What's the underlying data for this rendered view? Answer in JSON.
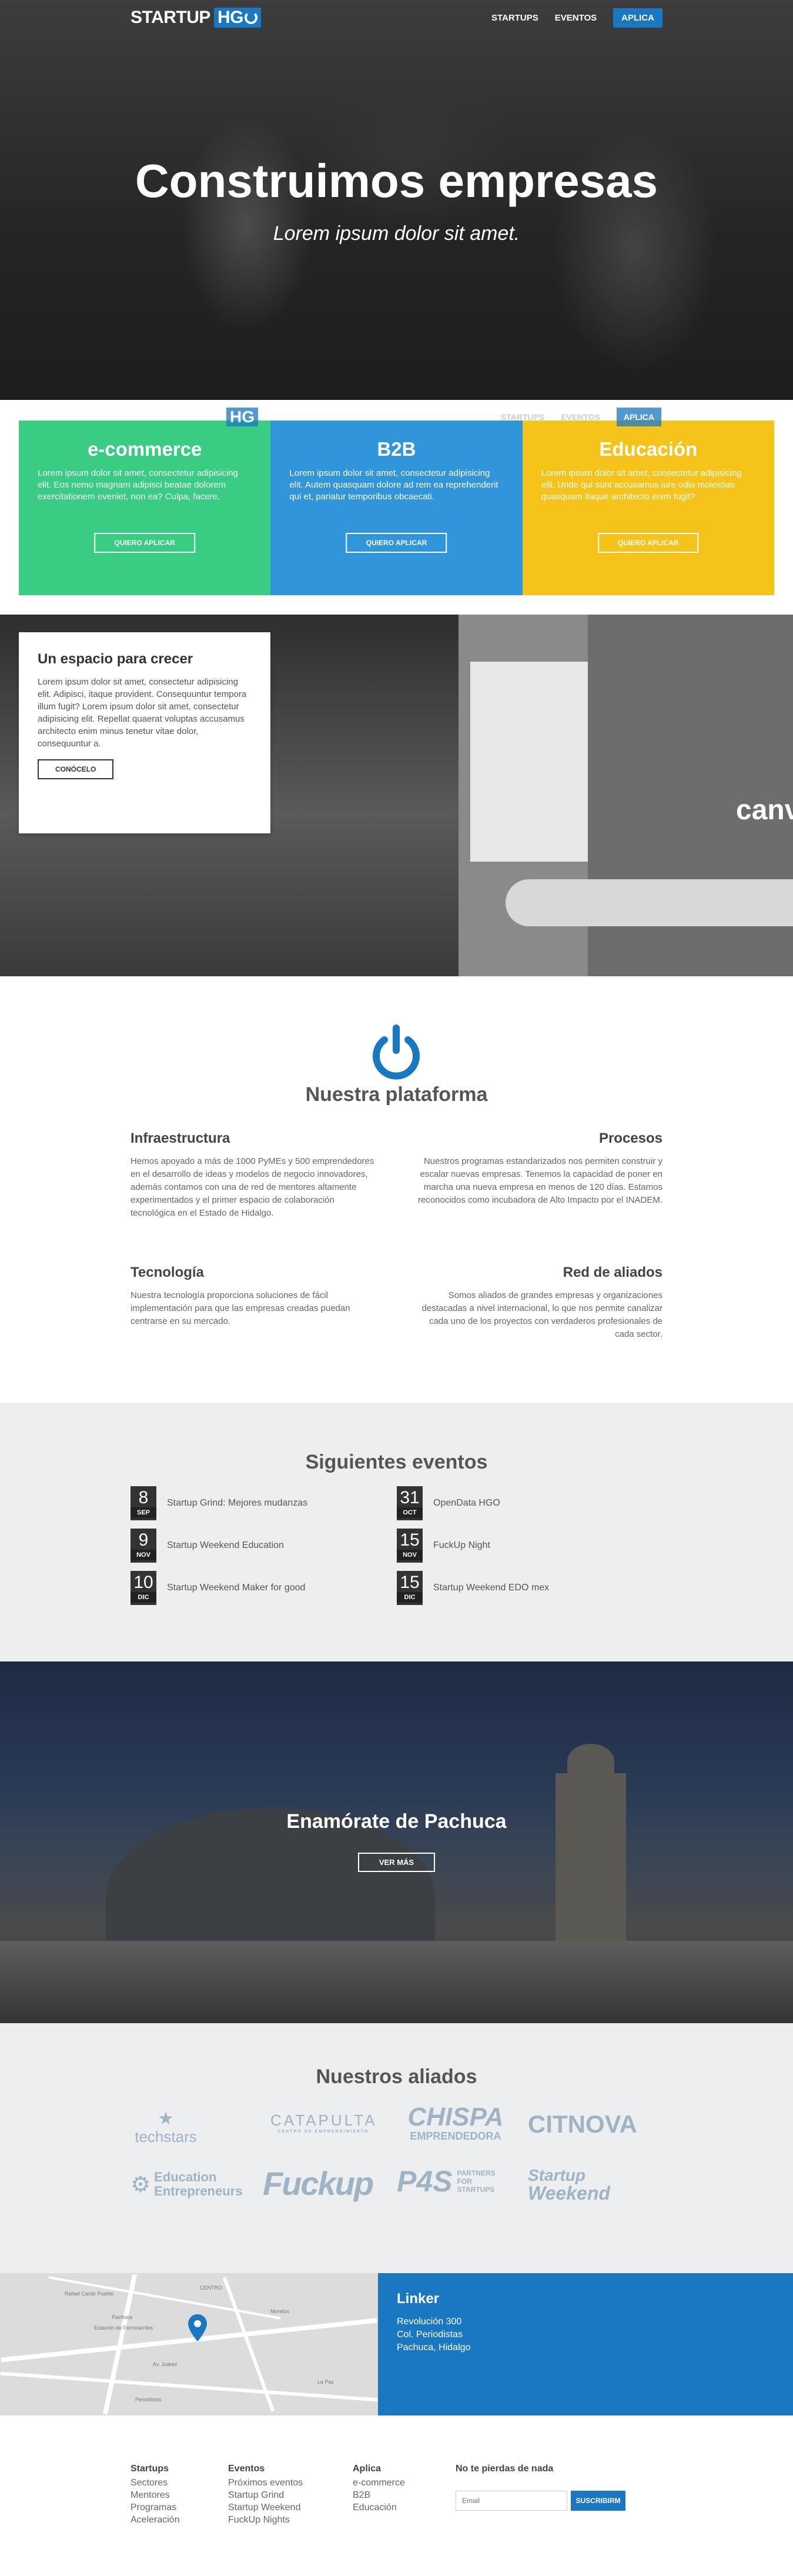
{
  "nav": {
    "logo_a": "STARTUP",
    "logo_b": "HG",
    "links": [
      "STARTUPS",
      "EVENTOS"
    ],
    "cta": "APLICA"
  },
  "hero": {
    "title": "Construimos empresas",
    "subtitle": "Lorem ipsum dolor sit amet."
  },
  "ghost_nav": {
    "logo": "HG",
    "links": [
      "STARTUPS",
      "EVENTOS"
    ],
    "cta": "APLICA"
  },
  "cards": [
    {
      "title": "e-commerce",
      "text": "Lorem ipsum dolor sit amet, consectetur adipisicing elit. Eos nemo magnam adipisci beatae dolorem exercitationem eveniet, non ea? Culpa, facere.",
      "button": "QUIERO APLICAR",
      "color": "#28c878"
    },
    {
      "title": "B2B",
      "text": "Lorem ipsum dolor sit amet, consectetur adipisicing elit. Autem quasquam dolore ad rem ea reprehenderit qui et, pariatur temporibus obcaecati.",
      "button": "QUIERO APLICAR",
      "color": "#1e8cd7"
    },
    {
      "title": "Educación",
      "text": "Lorem ipsum dolor sit amet, consectetur adipisicing elit. Unde qui sunt accusamus iure odio molestias quasquam itaque architecto enim fugit?",
      "button": "QUIERO APLICAR",
      "color": "#f5c00f"
    }
  ],
  "espacio": {
    "title": "Un espacio para crecer",
    "text": "Lorem ipsum dolor sit amet, consectetur adipisicing elit. Adipisci, itaque provident. Consequuntur tempora illum fugit? Lorem ipsum dolor sit amet, consectetur adipisicing elit. Repellat quaerat voluptas accusamus architecto enim minus tenetur vitae dolor, consequuntur a.",
    "button": "CONÓCELO",
    "photo_text": "canv"
  },
  "plataforma": {
    "title": "Nuestra plataforma",
    "items": [
      {
        "title": "Infraestructura",
        "text": "Hemos apoyado a más de 1000 PyMEs y 500 emprendedores en el desarrollo de ideas y modelos de negocio innovadores, además contamos con una de red de mentores altamente experimentados y el primer espacio de colaboración tecnológica en el Estado de Hidalgo."
      },
      {
        "title": "Procesos",
        "text": "Nuestros programas estandarizados nos permiten construir y escalar nuevas empresas. Tenemos la capacidad de poner en marcha una nueva empresa en menos de 120 días. Estamos reconocidos como incubadora de Alto Impacto por el INADEM."
      },
      {
        "title": "Tecnología",
        "text": "Nuestra tecnología proporciona soluciones de fácil implementación para que las empresas creadas puedan centrarse en su mercado."
      },
      {
        "title": "Red de aliados",
        "text": "Somos aliados de grandes empresas y organizaciones destacadas a nivel internacional, lo que nos permite canalizar cada uno de los proyectos con verdaderos profesionales de cada sector."
      }
    ]
  },
  "eventos": {
    "title": "Siguientes eventos",
    "left": [
      {
        "day": "8",
        "month": "SEP",
        "name": "Startup Grind: Mejores mudanzas"
      },
      {
        "day": "9",
        "month": "NOV",
        "name": "Startup Weekend Education"
      },
      {
        "day": "10",
        "month": "DIC",
        "name": "Startup Weekend Maker for good"
      }
    ],
    "right": [
      {
        "day": "31",
        "month": "OCT",
        "name": "OpenData HGO"
      },
      {
        "day": "15",
        "month": "NOV",
        "name": "FuckUp Night"
      },
      {
        "day": "15",
        "month": "DIC",
        "name": "Startup Weekend EDO mex"
      }
    ]
  },
  "pachuca": {
    "title": "Enamórate de Pachuca",
    "button": "VER MÁS"
  },
  "aliados": {
    "title": "Nuestros aliados",
    "logos": {
      "techstars": "techstars",
      "catapulta": "CATAPULTA",
      "catapulta_sub": "CENTRO DE EMPRENDIMIENTO",
      "chispa_1": "CHISPA",
      "chispa_2": "EMPRENDEDORA",
      "citnova": "CITNOVA",
      "education_1": "Education",
      "education_2": "Entrepreneurs",
      "fuckup": "Fuckup",
      "p4s": "P4S",
      "p4s_1": "PARTNERS",
      "p4s_2": "FOR",
      "p4s_3": "STARTUPS",
      "sw_1": "Startup",
      "sw_2": "Weekend"
    }
  },
  "map": {
    "labels": [
      "Rafael Cardo Pueblo",
      "Pachuca",
      "Estación de Ferrocarriles",
      "CENTRO",
      "La Paz",
      "Morelos",
      "Av. Juárez",
      "Periodistas"
    ]
  },
  "linker": {
    "title": "Linker",
    "line1": "Revolución 300",
    "line2": "Col. Periodistas",
    "line3": "Pachuca, Hidalgo"
  },
  "footer": {
    "cols": [
      {
        "title": "Startups",
        "items": [
          "Sectores",
          "Mentores",
          "Programas",
          "Aceleración"
        ]
      },
      {
        "title": "Eventos",
        "items": [
          "Próximos eventos",
          "Startup Grind",
          "Startup Weekend",
          "FuckUp Nights"
        ]
      },
      {
        "title": "Aplica",
        "items": [
          "e-commerce",
          "B2B",
          "Educación"
        ]
      }
    ],
    "newsletter_title": "No te pierdas de nada",
    "email_placeholder": "Email",
    "subscribe": "SUSCRIBIRM"
  },
  "colors": {
    "brand_blue": "#1a78c2",
    "green": "#28c878",
    "yellow": "#f5c00f",
    "event_gray": "#eceef0"
  }
}
